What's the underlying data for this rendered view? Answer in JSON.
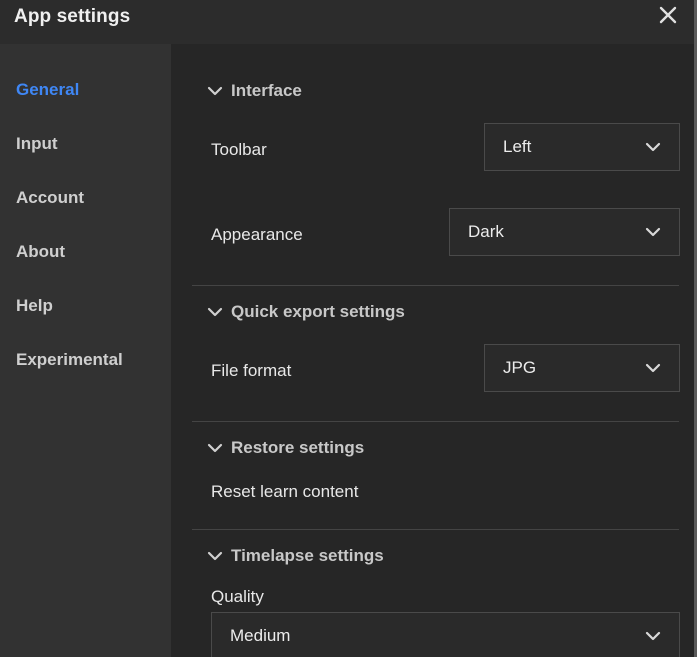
{
  "window": {
    "title": "App settings"
  },
  "sidebar": {
    "items": [
      {
        "label": "General",
        "active": true
      },
      {
        "label": "Input"
      },
      {
        "label": "Account"
      },
      {
        "label": "About"
      },
      {
        "label": "Help"
      },
      {
        "label": "Experimental"
      }
    ]
  },
  "sections": {
    "interface": {
      "title": "Interface",
      "toolbar_label": "Toolbar",
      "toolbar_value": "Left",
      "appearance_label": "Appearance",
      "appearance_value": "Dark"
    },
    "quick_export": {
      "title": "Quick export settings",
      "file_format_label": "File format",
      "file_format_value": "JPG"
    },
    "restore": {
      "title": "Restore settings",
      "reset_label": "Reset learn content"
    },
    "timelapse": {
      "title": "Timelapse settings",
      "quality_label": "Quality",
      "quality_value": "Medium"
    }
  },
  "colors": {
    "accent": "#3f87f5",
    "background": "#262626",
    "sidebar": "#323232"
  },
  "icons": {
    "close": "close-icon",
    "chevron": "chevron-down-icon"
  }
}
